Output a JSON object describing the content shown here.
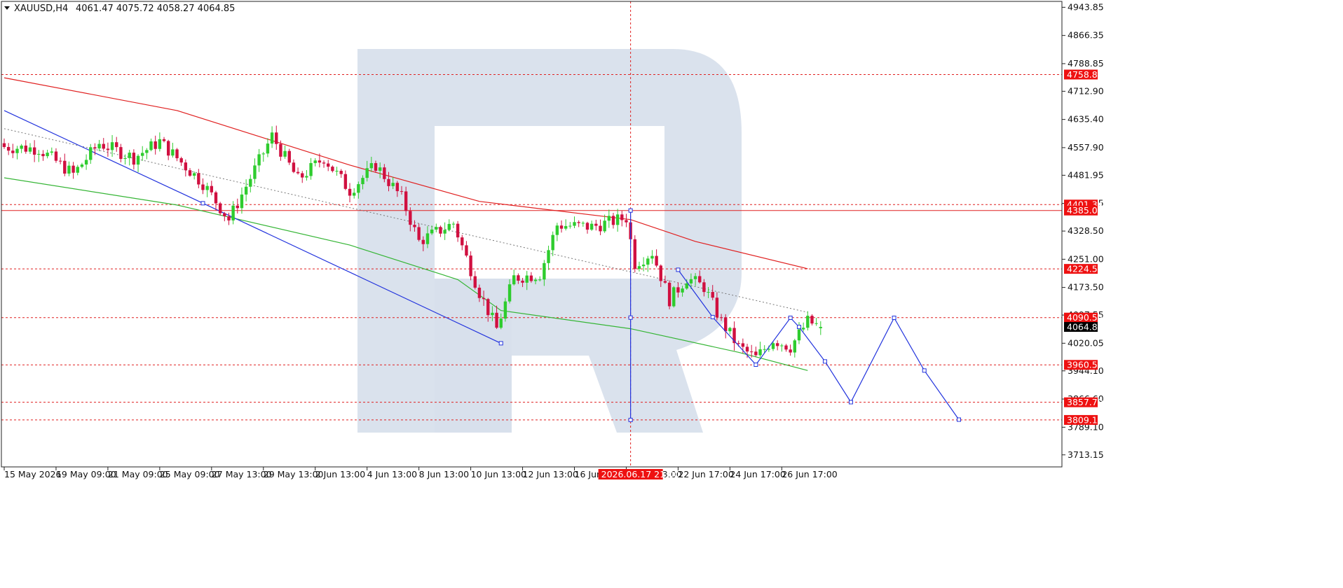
{
  "header": {
    "symbol": "XAUUSD,H4",
    "ohlc": "4061.47 4075.72 4058.27 4064.85"
  },
  "colors": {
    "bull": "#2ecc2e",
    "bear": "#d01040",
    "level_line": "#e02020",
    "level_label_bg": "#ee1111",
    "price_label_bg": "#000000",
    "ma_red": "#e02020",
    "ma_green": "#35b535",
    "forecast": "#2233dd",
    "trend_dotted": "#777777",
    "watermark": "#d8e0ec"
  },
  "crosshair": {
    "time_label": "2026.06.17 21:00",
    "time_index": 145
  },
  "chart_data": {
    "type": "candlestick",
    "instrument": "XAUUSD",
    "timeframe": "H4",
    "ylim": [
      3680,
      4960
    ],
    "x_range": [
      0,
      230
    ],
    "y_ticks": [
      "4943.85",
      "4866.35",
      "4788.85",
      "4712.90",
      "4635.40",
      "4557.90",
      "4481.95",
      "4404.45",
      "4328.50",
      "4251.00",
      "4173.50",
      "4097.55",
      "4020.05",
      "3944.10",
      "3866.60",
      "3789.10",
      "3713.15"
    ],
    "x_ticks": [
      {
        "i": 0,
        "label": "15 May 2026"
      },
      {
        "i": 12,
        "label": "19 May 09:00"
      },
      {
        "i": 24,
        "label": "21 May 09:00"
      },
      {
        "i": 36,
        "label": "25 May 09:00"
      },
      {
        "i": 48,
        "label": "27 May 13:00"
      },
      {
        "i": 60,
        "label": "29 May 13:00"
      },
      {
        "i": 72,
        "label": "2 Jun 13:00"
      },
      {
        "i": 84,
        "label": "4 Jun 13:00"
      },
      {
        "i": 96,
        "label": "8 Jun 13:00"
      },
      {
        "i": 108,
        "label": "10 Jun 13:00"
      },
      {
        "i": 120,
        "label": "12 Jun 13:00"
      },
      {
        "i": 132,
        "label": "16 Jun 13:00"
      },
      {
        "i": 144,
        "label": "18 Jun 13:00"
      },
      {
        "i": 156,
        "label": "22 Jun 17:00"
      },
      {
        "i": 168,
        "label": "24 Jun 17:00"
      },
      {
        "i": 180,
        "label": "26 Jun 17:00"
      }
    ],
    "levels": [
      {
        "price": 4758.89,
        "label": "4758.89",
        "style": "dashed"
      },
      {
        "price": 4401.34,
        "label": "4401.34",
        "style": "dashed"
      },
      {
        "price": 4385.01,
        "label": "4385.01",
        "style": "solid"
      },
      {
        "price": 4224.5,
        "label": "4224.50",
        "style": "dashed"
      },
      {
        "price": 4090.52,
        "label": "4090.52",
        "style": "dashed"
      },
      {
        "price": 3960.56,
        "label": "3960.56",
        "style": "dashed"
      },
      {
        "price": 3857.7,
        "label": "3857.70",
        "style": "dashed"
      },
      {
        "price": 3809.1,
        "label": "3809.10",
        "style": "dashed"
      }
    ],
    "current_price": {
      "price": 4064.85,
      "label": "4064.85"
    },
    "anchors": [
      [
        0,
        4560
      ],
      [
        8,
        4555
      ],
      [
        16,
        4485
      ],
      [
        22,
        4570
      ],
      [
        30,
        4530
      ],
      [
        36,
        4575
      ],
      [
        46,
        4460
      ],
      [
        52,
        4360
      ],
      [
        62,
        4590
      ],
      [
        68,
        4470
      ],
      [
        74,
        4530
      ],
      [
        80,
        4440
      ],
      [
        86,
        4510
      ],
      [
        92,
        4420
      ],
      [
        96,
        4300
      ],
      [
        104,
        4350
      ],
      [
        110,
        4160
      ],
      [
        114,
        4060
      ],
      [
        118,
        4200
      ],
      [
        124,
        4210
      ],
      [
        128,
        4345
      ],
      [
        136,
        4340
      ],
      [
        144,
        4365
      ],
      [
        146,
        4240
      ],
      [
        150,
        4270
      ],
      [
        154,
        4140
      ],
      [
        158,
        4200
      ],
      [
        162,
        4175
      ],
      [
        166,
        4080
      ],
      [
        170,
        4010
      ],
      [
        174,
        3980
      ],
      [
        178,
        4030
      ],
      [
        182,
        4010
      ],
      [
        186,
        4080
      ],
      [
        189,
        4064.85
      ]
    ],
    "ma_red": [
      [
        0,
        4750
      ],
      [
        40,
        4660
      ],
      [
        80,
        4510
      ],
      [
        110,
        4410
      ],
      [
        145,
        4360
      ],
      [
        160,
        4300
      ],
      [
        186,
        4225
      ]
    ],
    "ma_green": [
      [
        0,
        4475
      ],
      [
        40,
        4400
      ],
      [
        80,
        4290
      ],
      [
        105,
        4195
      ],
      [
        115,
        4110
      ],
      [
        145,
        4060
      ],
      [
        170,
        3995
      ],
      [
        186,
        3945
      ]
    ],
    "trend_dotted": [
      [
        0,
        4610
      ],
      [
        186,
        4105
      ]
    ],
    "history_wave": [
      [
        0,
        4660
      ],
      [
        46,
        4405
      ],
      [
        115,
        4020
      ]
    ],
    "forecast_path": [
      [
        156,
        4222
      ],
      [
        164,
        4092
      ],
      [
        174,
        3961
      ],
      [
        182,
        4090
      ],
      [
        184,
        4064.85
      ],
      [
        190,
        3970
      ],
      [
        196,
        3858
      ],
      [
        206,
        4090
      ],
      [
        213,
        3945
      ],
      [
        221,
        3810
      ]
    ],
    "crosshair_price": 4090.52
  }
}
